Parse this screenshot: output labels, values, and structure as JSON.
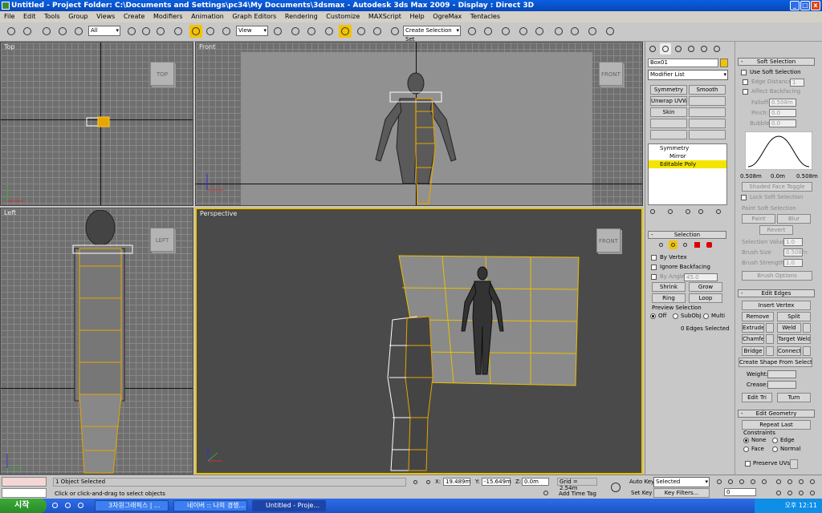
{
  "window": {
    "title": "Untitled      - Project Folder: C:\\Documents and Settings\\pc34\\My Documents\\3dsmax      - Autodesk 3ds Max  2009      - Display : Direct 3D"
  },
  "menu": [
    "File",
    "Edit",
    "Tools",
    "Group",
    "Views",
    "Create",
    "Modifiers",
    "Animation",
    "Graph Editors",
    "Rendering",
    "Customize",
    "MAXScript",
    "Help",
    "OgreMax",
    "Tentacles"
  ],
  "toolbar": {
    "filter": "All",
    "refcoord": "View",
    "selset": "Create Selection Set"
  },
  "viewports": {
    "top": "Top",
    "front": "Front",
    "left": "Left",
    "perspective": "Perspective",
    "cube_top": "TOP",
    "cube_front": "FRONT",
    "cube_left": "LEFT",
    "cube_persp": "FRONT"
  },
  "modify": {
    "object_name": "Box01",
    "object_color": "#f3c300",
    "modifier_list": "Modifier List",
    "buttons": [
      "Symmetry",
      "Smooth",
      "Unwrap UVW",
      "",
      "Skin",
      ""
    ],
    "stack": [
      "Symmetry",
      "Mirror",
      "Editable Poly"
    ],
    "selection": {
      "title": "Selection",
      "by_vertex": "By Vertex",
      "ignore_backfacing": "Ignore Backfacing",
      "by_angle": "By Angle:",
      "angle": "45.0",
      "shrink": "Shrink",
      "grow": "Grow",
      "ring": "Ring",
      "loop": "Loop",
      "preview": "Preview Selection",
      "off": "Off",
      "subobj": "SubObj",
      "multi": "Multi",
      "status": "0 Edges Selected"
    }
  },
  "soft": {
    "title": "Soft Selection",
    "use": "Use Soft Selection",
    "edge_distance": "Edge Distance:",
    "edge_distance_val": "1",
    "affect_backfacing": "Affect Backfacing",
    "falloff": "Falloff:",
    "falloff_val": "0.508m",
    "pinch": "Pinch:",
    "pinch_val": "0.0",
    "bubble": "Bubble:",
    "bubble_val": "0.0",
    "axis_left": "0.508m",
    "axis_mid": "0.0m",
    "axis_right": "0.508m",
    "shaded_toggle": "Shaded Face Toggle",
    "lock": "Lock Soft Selection",
    "paint_group": "Paint Soft Selection",
    "paint": "Paint",
    "blur": "Blur",
    "revert": "Revert",
    "sel_value": "Selection Value",
    "sel_value_val": "1.0",
    "brush_size": "Brush Size",
    "brush_size_val": "0.508m",
    "brush_strength": "Brush Strength",
    "brush_strength_val": "1.0",
    "brush_options": "Brush Options"
  },
  "edit_edges": {
    "title": "Edit Edges",
    "insert_vertex": "Insert Vertex",
    "remove": "Remove",
    "split": "Split",
    "extrude": "Extrude",
    "weld": "Weld",
    "chamfer": "Chamfer",
    "target_weld": "Target Weld",
    "bridge": "Bridge",
    "connect": "Connect",
    "create_shape": "Create Shape From Selection",
    "weight": "Weight:",
    "crease": "Crease:",
    "edit_tri": "Edit Tri",
    "turn": "Turn"
  },
  "edit_geometry": {
    "title": "Edit Geometry",
    "repeat_last": "Repeat Last",
    "constraints": "Constraints",
    "none": "None",
    "edge": "Edge",
    "face": "Face",
    "normal": "Normal",
    "preserve_uvs": "Preserve UVs"
  },
  "status": {
    "selected": "1 Object Selected",
    "prompt": "Click or click-and-drag to select objects",
    "x": "19.489m",
    "y": "-15.649m",
    "z": "0.0m",
    "grid": "Grid = 2.54m",
    "auto_key": "Auto Key",
    "set_key": "Set Key",
    "key_mode": "Selected",
    "key_filters": "Key Filters...",
    "add_time_tag": "Add Time Tag",
    "frame": "0",
    "x_label": "X:",
    "y_label": "Y:",
    "z_label": "Z:"
  },
  "taskbar": {
    "start": "시작",
    "tasks": [
      "3차원그래픽스 | ...",
      "네이버 :: 나의 경쟁...",
      "Untitled      - Proje..."
    ],
    "clock": "오후 12:11"
  }
}
